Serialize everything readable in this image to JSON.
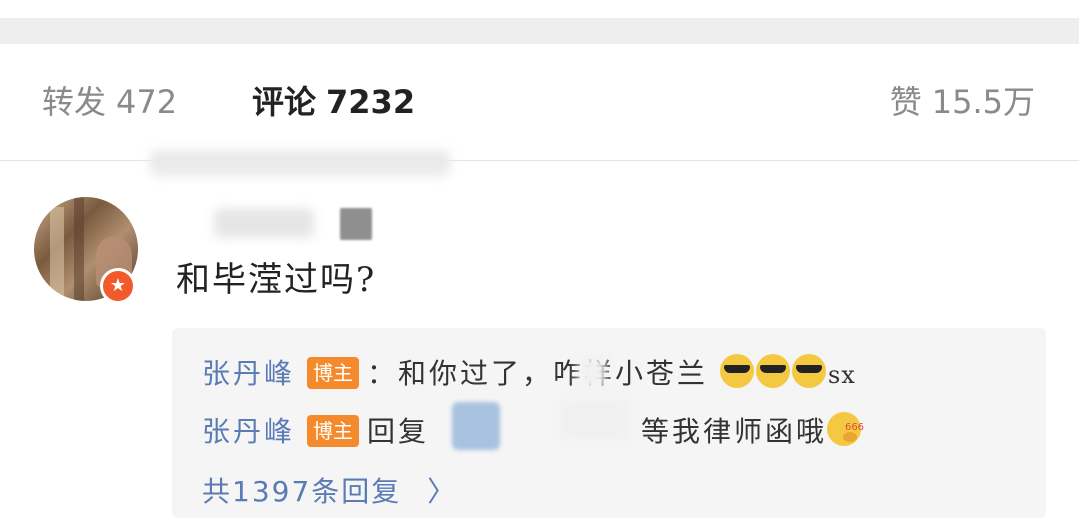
{
  "stats": {
    "repost_label": "转发",
    "repost_count": "472",
    "comment_label": "评论",
    "comment_count": "7232",
    "like_label": "赞",
    "like_count": "15.5万"
  },
  "comment": {
    "text": "和毕滢过吗?",
    "replies": [
      {
        "author": "张丹峰",
        "tag": "博主",
        "text": "：和你过了，咋样小苍兰",
        "emoji": [
          "cool-face-icon",
          "cool-face-icon",
          "cool-face-icon"
        ],
        "suffix": "sx"
      },
      {
        "author": "张丹峰",
        "tag": "博主",
        "prefix": "回复",
        "text": "等我律师函哦",
        "emoji": [
          "thinking-face-icon"
        ]
      }
    ],
    "more_replies": "共1397条回复",
    "chevron": "〉"
  },
  "colors": {
    "link_blue": "#5b7bb5",
    "tag_orange": "#f58a2c",
    "verify_red": "#f25a2c"
  }
}
